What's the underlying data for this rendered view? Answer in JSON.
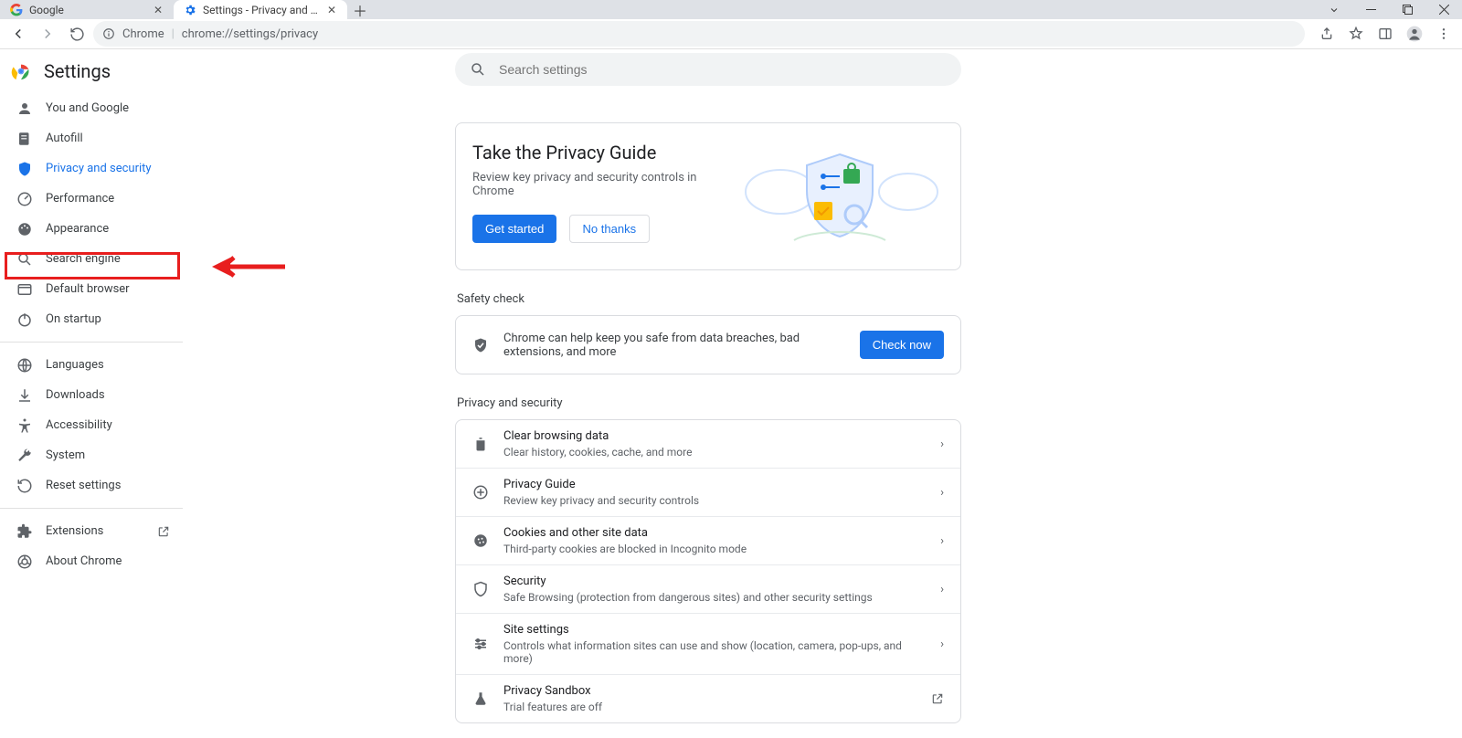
{
  "tabs": {
    "items": [
      {
        "title": "Google"
      },
      {
        "title": "Settings - Privacy and security"
      }
    ]
  },
  "address_bar": {
    "chip": "Chrome",
    "url": "chrome://settings/privacy"
  },
  "header": {
    "title": "Settings"
  },
  "search": {
    "placeholder": "Search settings"
  },
  "sidebar": {
    "items": [
      {
        "label": "You and Google"
      },
      {
        "label": "Autofill"
      },
      {
        "label": "Privacy and security"
      },
      {
        "label": "Performance"
      },
      {
        "label": "Appearance"
      },
      {
        "label": "Search engine"
      },
      {
        "label": "Default browser"
      },
      {
        "label": "On startup"
      }
    ],
    "items2": [
      {
        "label": "Languages"
      },
      {
        "label": "Downloads"
      },
      {
        "label": "Accessibility"
      },
      {
        "label": "System"
      },
      {
        "label": "Reset settings"
      }
    ],
    "items3": [
      {
        "label": "Extensions"
      },
      {
        "label": "About Chrome"
      }
    ]
  },
  "promo": {
    "title": "Take the Privacy Guide",
    "subtitle": "Review key privacy and security controls in Chrome",
    "get_started": "Get started",
    "no_thanks": "No thanks"
  },
  "safety": {
    "section": "Safety check",
    "text": "Chrome can help keep you safe from data breaches, bad extensions, and more",
    "check_now": "Check now"
  },
  "privacy": {
    "section": "Privacy and security",
    "rows": [
      {
        "title": "Clear browsing data",
        "sub": "Clear history, cookies, cache, and more"
      },
      {
        "title": "Privacy Guide",
        "sub": "Review key privacy and security controls"
      },
      {
        "title": "Cookies and other site data",
        "sub": "Third-party cookies are blocked in Incognito mode"
      },
      {
        "title": "Security",
        "sub": "Safe Browsing (protection from dangerous sites) and other security settings"
      },
      {
        "title": "Site settings",
        "sub": "Controls what information sites can use and show (location, camera, pop-ups, and more)"
      },
      {
        "title": "Privacy Sandbox",
        "sub": "Trial features are off"
      }
    ]
  }
}
